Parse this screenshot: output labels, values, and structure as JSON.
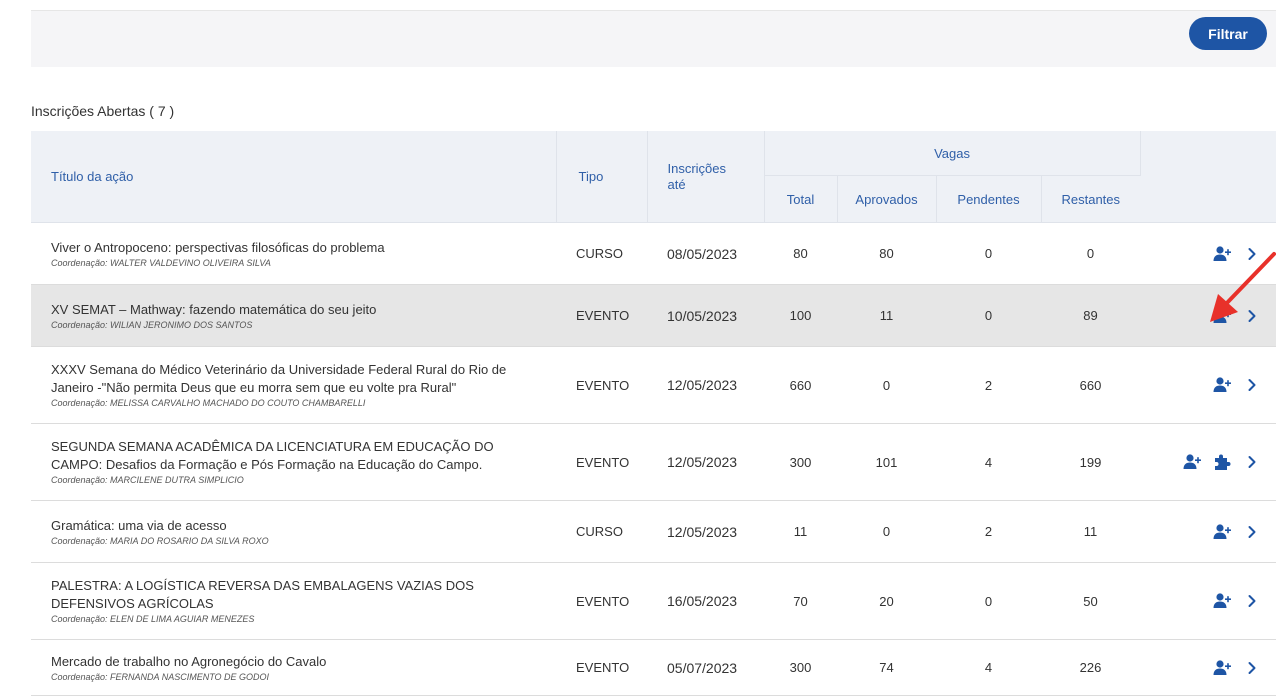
{
  "toolbar": {
    "filter_label": "Filtrar"
  },
  "section": {
    "title": "Inscrições Abertas ( 7 )"
  },
  "table": {
    "headers": {
      "title": "Título da ação",
      "tipo": "Tipo",
      "inscricoes": "Inscrições até",
      "vagas": "Vagas",
      "total": "Total",
      "aprovados": "Aprovados",
      "pendentes": "Pendentes",
      "restantes": "Restantes"
    },
    "rows": [
      {
        "title": "Viver o Antropoceno: perspectivas filosóficas do problema",
        "coord": "Coordenação: WALTER VALDEVINO OLIVEIRA SILVA",
        "tipo": "CURSO",
        "date": "08/05/2023",
        "total": "80",
        "aprovados": "80",
        "pendentes": "0",
        "restantes": "0",
        "icons": [
          "add-user-icon",
          "chevron-right-icon"
        ]
      },
      {
        "title": "XV SEMAT – Mathway: fazendo matemática do seu jeito",
        "coord": "Coordenação: WILIAN JERONIMO DOS SANTOS",
        "tipo": "EVENTO",
        "date": "10/05/2023",
        "total": "100",
        "aprovados": "11",
        "pendentes": "0",
        "restantes": "89",
        "highlighted": true,
        "icons": [
          "add-user-icon",
          "chevron-right-icon"
        ]
      },
      {
        "title": "XXXV Semana do Médico Veterinário da Universidade Federal Rural do Rio de Janeiro -\"Não permita Deus que eu morra sem que eu volte pra Rural\"",
        "coord": "Coordenação: MELISSA CARVALHO MACHADO DO COUTO CHAMBARELLI",
        "tipo": "EVENTO",
        "date": "12/05/2023",
        "total": "660",
        "aprovados": "0",
        "pendentes": "2",
        "restantes": "660",
        "icons": [
          "add-user-icon",
          "chevron-right-icon"
        ]
      },
      {
        "title": "SEGUNDA SEMANA ACADÊMICA DA LICENCIATURA EM EDUCAÇÃO DO CAMPO: Desafios da Formação e Pós Formação na Educação do Campo.",
        "coord": "Coordenação: MARCILENE DUTRA SIMPLICIO",
        "tipo": "EVENTO",
        "date": "12/05/2023",
        "total": "300",
        "aprovados": "101",
        "pendentes": "4",
        "restantes": "199",
        "icons": [
          "add-user-icon",
          "puzzle-icon",
          "chevron-right-icon"
        ]
      },
      {
        "title": "Gramática: uma via de acesso",
        "coord": "Coordenação: MARIA DO ROSARIO DA SILVA ROXO",
        "tipo": "CURSO",
        "date": "12/05/2023",
        "total": "11",
        "aprovados": "0",
        "pendentes": "2",
        "restantes": "11",
        "icons": [
          "add-user-icon",
          "chevron-right-icon"
        ]
      },
      {
        "title": "PALESTRA: A LOGÍSTICA REVERSA DAS EMBALAGENS VAZIAS DOS DEFENSIVOS AGRÍCOLAS",
        "coord": "Coordenação: ELEN DE LIMA AGUIAR MENEZES",
        "tipo": "EVENTO",
        "date": "16/05/2023",
        "total": "70",
        "aprovados": "20",
        "pendentes": "0",
        "restantes": "50",
        "icons": [
          "add-user-icon",
          "chevron-right-icon"
        ]
      },
      {
        "title": "Mercado de trabalho no Agronegócio do Cavalo",
        "coord": "Coordenação: FERNANDA NASCIMENTO DE GODOI",
        "tipo": "EVENTO",
        "date": "05/07/2023",
        "total": "300",
        "aprovados": "74",
        "pendentes": "4",
        "restantes": "226",
        "icons": [
          "add-user-icon",
          "chevron-right-icon"
        ]
      }
    ]
  },
  "colors": {
    "primary": "#1e55a5",
    "header_bg": "#eef1f6",
    "header_text": "#2f5fa8",
    "highlight_row": "#e6e6e6",
    "annotation_arrow": "#e8312a"
  }
}
